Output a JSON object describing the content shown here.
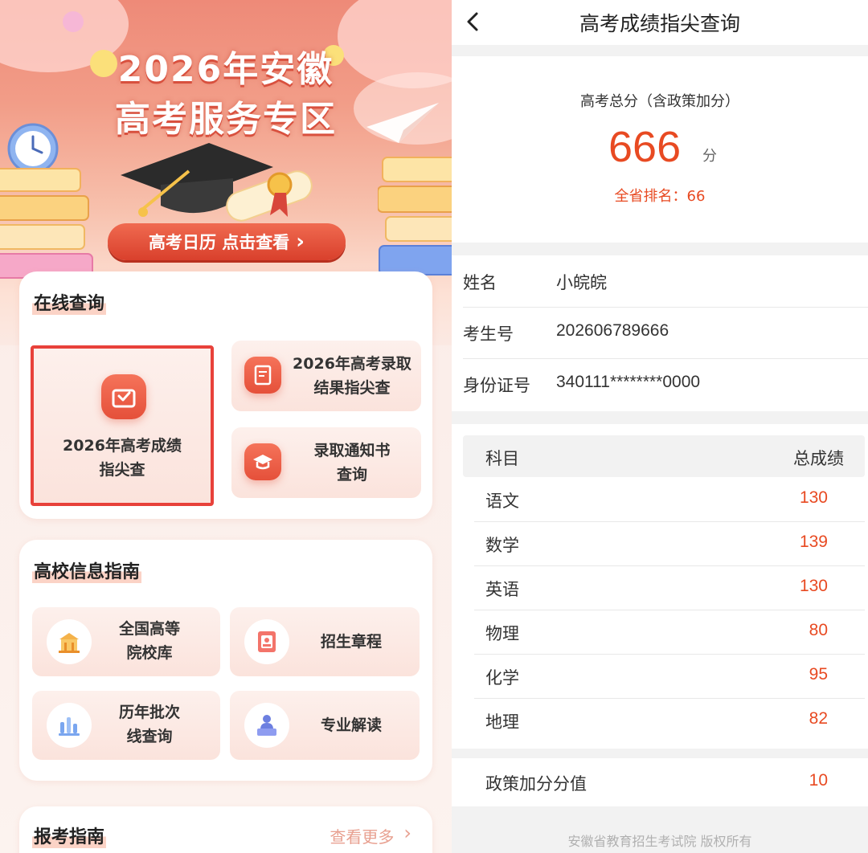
{
  "left": {
    "hero": {
      "title_line1": "2026年安徽",
      "title_line2": "高考服务专区",
      "calendar_button": "高考日历 点击查看",
      "calendar_arrow": "›"
    },
    "online_query": {
      "title": "在线查询",
      "main_tile_line1": "2026年高考成绩",
      "main_tile_line2": "指尖查",
      "tile_admission_line1": "2026年高考录取",
      "tile_admission_line2": "结果指尖查",
      "tile_notice_line1": "录取通知书",
      "tile_notice_line2": "查询"
    },
    "college_guide": {
      "title": "高校信息指南",
      "tile_colleges_line1": "全国高等",
      "tile_colleges_line2": "院校库",
      "tile_charter": "招生章程",
      "tile_batch_line1": "历年批次",
      "tile_batch_line2": "线查询",
      "tile_major": "专业解读"
    },
    "exam_guide": {
      "title": "报考指南",
      "more": "查看更多",
      "more_arrow": "›"
    }
  },
  "right": {
    "header": {
      "title": "高考成绩指尖查询",
      "back_icon": "chevron-left-icon"
    },
    "score": {
      "caption": "高考总分（含政策加分）",
      "value": "666",
      "unit": "分",
      "rank": "全省排名：66"
    },
    "info": [
      {
        "label": "姓名",
        "value": "小皖皖"
      },
      {
        "label": "考生号",
        "value": "202606789666"
      },
      {
        "label": "身份证号",
        "value": "340111********0000"
      }
    ],
    "table": {
      "header_subject": "科目",
      "header_total": "总成绩",
      "rows": [
        {
          "subject": "语文",
          "score": "130"
        },
        {
          "subject": "数学",
          "score": "139"
        },
        {
          "subject": "英语",
          "score": "130"
        },
        {
          "subject": "物理",
          "score": "80"
        },
        {
          "subject": "化学",
          "score": "95"
        },
        {
          "subject": "地理",
          "score": "82"
        }
      ]
    },
    "policy": {
      "label": "政策加分分值",
      "value": "10"
    },
    "copyright": "安徽省教育招生考试院 版权所有"
  },
  "colors": {
    "accent": "#e84a22",
    "hero_top": "#ee8a78",
    "highlight_border": "#e8413a"
  }
}
